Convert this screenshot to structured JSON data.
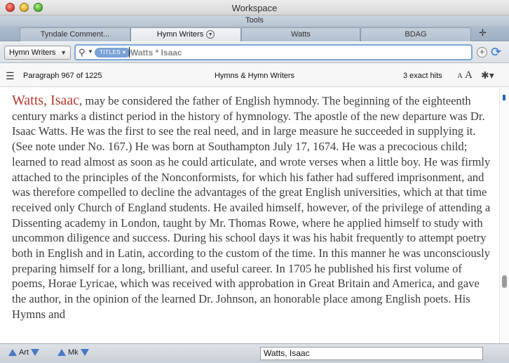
{
  "window": {
    "title": "Workspace",
    "toolbar_label": "Tools"
  },
  "tabs": [
    {
      "label": "Tyndale Comment...",
      "active": false
    },
    {
      "label": "Hymn Writers",
      "active": true
    },
    {
      "label": "Watts",
      "active": false
    },
    {
      "label": "BDAG",
      "active": false
    }
  ],
  "search": {
    "resource_selector": "Hymn Writers",
    "field_tag": "TITLES",
    "query": "Watts * Isaac"
  },
  "info": {
    "paragraph": "Paragraph 967 of 1225",
    "resource_title": "Hymns & Hymn Writers",
    "hits": "3 exact hits",
    "font_small": "A",
    "font_large": "A"
  },
  "article": {
    "headword": "Watts, Isaac",
    "text": ", may be considered the father of English hymnody. The beginning of the eighteenth century marks a distinct period in the history of hymnology. The apostle of the new departure was Dr. Isaac Watts. He was the first to see the real need, and in large measure he succeeded in supplying it. (See note under No. 167.) He was born at Southampton July 17, 1674. He was a precocious child; learned to read almost as soon as he could articulate, and wrote verses when a little boy. He was firmly attached to the principles of the Nonconformists, for which his father had suffered imprisonment, and was therefore compelled to decline the advantages of the great English universities, which at that time received only Church of England students. He availed himself, however, of the privilege of attending a Dissenting academy in London, taught by Mr. Thomas Rowe, where he applied himself to study with uncommon diligence and success. During his school days it was his habit frequently to attempt poetry both in English and in Latin, according to the custom of the time. In this manner he was unconsciously preparing himself for a long, brilliant, and useful career. In 1705 he published his first volume of poems, Horae Lyricae, which was received with approbation in Great Britain and America, and gave the author, in the opinion of the learned Dr. Johnson, an honorable place among English poets. His Hymns and"
  },
  "bottom": {
    "art_label": "Art",
    "mk_label": "Mk",
    "find_value": "Watts, Isaac"
  },
  "colors": {
    "accent": "#4a78c4",
    "headword": "#b5392c",
    "pill": "#7aa2d6"
  },
  "icons": [
    "search-icon",
    "sync-icon",
    "list-icon",
    "gear-icon",
    "add-icon"
  ]
}
